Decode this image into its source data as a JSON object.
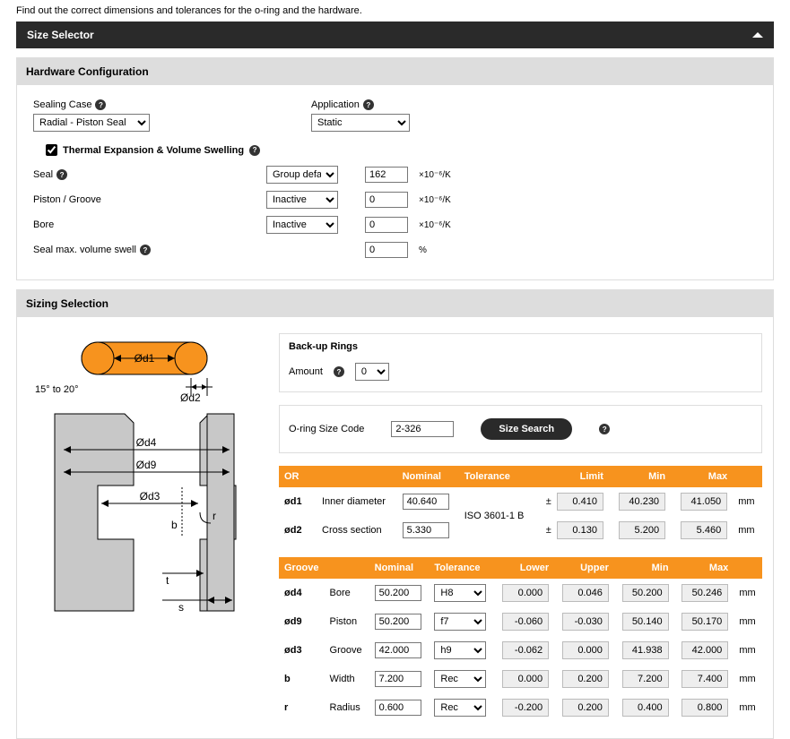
{
  "intro": "Find out the correct dimensions and tolerances for the o-ring and the hardware.",
  "header": {
    "title": "Size Selector"
  },
  "hw": {
    "title": "Hardware Configuration",
    "sealing_label": "Sealing Case",
    "sealing_value": "Radial - Piston Seal",
    "app_label": "Application",
    "app_value": "Static",
    "thermal_label": "Thermal Expansion & Volume Swelling",
    "seal_lbl": "Seal",
    "pg_lbl": "Piston / Groove",
    "bore_lbl": "Bore",
    "swell_lbl": "Seal max. volume swell",
    "seal_sel": "Group default",
    "pg_sel": "Inactive",
    "bore_sel": "Inactive",
    "seal_val": "162",
    "pg_val": "0",
    "bore_val": "0",
    "swell_val": "0",
    "k_unit": "×10⁻⁶/K",
    "pct_unit": "%"
  },
  "sizing": {
    "title": "Sizing Selection",
    "backup_title": "Back-up Rings",
    "amount_lbl": "Amount",
    "amount_val": "0",
    "code_lbl": "O-ring Size Code",
    "code_val": "2-326",
    "search_btn": "Size Search"
  },
  "or_table": {
    "hdr": {
      "c0": "OR",
      "c1": "",
      "c2": "Nominal",
      "c3": "Tolerance",
      "c4": "Limit",
      "c5": "Min",
      "c6": "Max"
    },
    "tol_text": "ISO 3601-1 B",
    "rows": [
      {
        "sym": "ød1",
        "name": "Inner diameter",
        "nom": "40.640",
        "pm": "±",
        "limit": "0.410",
        "min": "40.230",
        "max": "41.050",
        "unit": "mm"
      },
      {
        "sym": "ød2",
        "name": "Cross section",
        "nom": "5.330",
        "pm": "±",
        "limit": "0.130",
        "min": "5.200",
        "max": "5.460",
        "unit": "mm"
      }
    ]
  },
  "gr_table": {
    "hdr": {
      "c0": "Groove",
      "c1": "",
      "c2": "Nominal",
      "c3": "Tolerance",
      "c4": "Lower",
      "c5": "Upper",
      "c6": "Min",
      "c7": "Max"
    },
    "rows": [
      {
        "sym": "ød4",
        "name": "Bore",
        "nom": "50.200",
        "tol": "H8",
        "low": "0.000",
        "up": "0.046",
        "min": "50.200",
        "max": "50.246",
        "unit": "mm"
      },
      {
        "sym": "ød9",
        "name": "Piston",
        "nom": "50.200",
        "tol": "f7",
        "low": "-0.060",
        "up": "-0.030",
        "min": "50.140",
        "max": "50.170",
        "unit": "mm"
      },
      {
        "sym": "ød3",
        "name": "Groove",
        "nom": "42.000",
        "tol": "h9",
        "low": "-0.062",
        "up": "0.000",
        "min": "41.938",
        "max": "42.000",
        "unit": "mm"
      },
      {
        "sym": "b",
        "name": "Width",
        "nom": "7.200",
        "tol": "Rec",
        "low": "0.000",
        "up": "0.200",
        "min": "7.200",
        "max": "7.400",
        "unit": "mm"
      },
      {
        "sym": "r",
        "name": "Radius",
        "nom": "0.600",
        "tol": "Rec",
        "low": "-0.200",
        "up": "0.200",
        "min": "0.400",
        "max": "0.800",
        "unit": "mm"
      }
    ]
  },
  "diagram": {
    "angle": "15° to 20°",
    "d1": "Ød1",
    "d2": "Ød2",
    "d3": "Ød3",
    "d4": "Ød4",
    "d9": "Ød9",
    "b": "b",
    "t": "t",
    "s": "s",
    "r": "r"
  }
}
